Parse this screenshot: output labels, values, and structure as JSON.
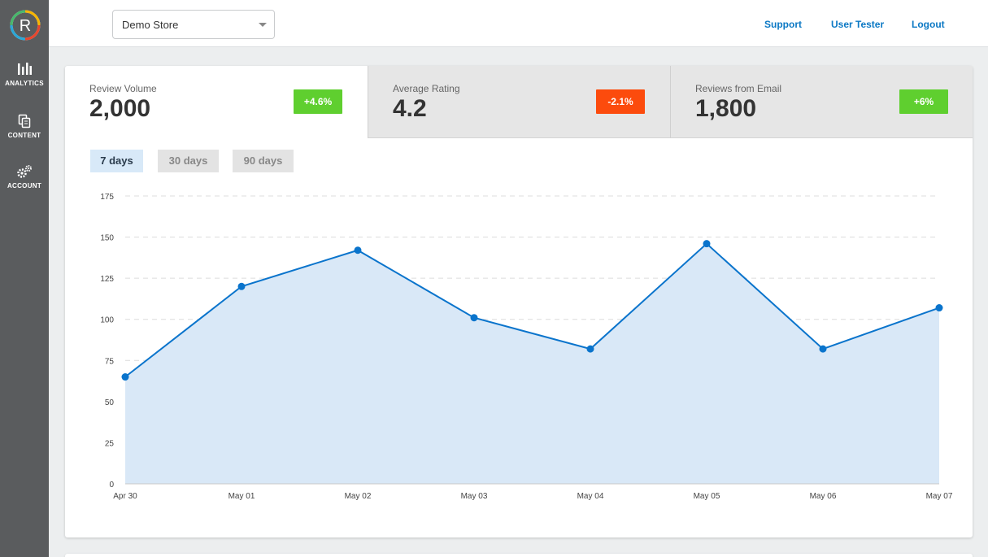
{
  "sidebar": {
    "logo_letter": "R",
    "items": [
      {
        "label": "ANALYTICS",
        "icon": "bar-chart-icon"
      },
      {
        "label": "CONTENT",
        "icon": "documents-icon"
      },
      {
        "label": "ACCOUNT",
        "icon": "gears-icon"
      }
    ]
  },
  "header": {
    "store_selected": "Demo Store",
    "links": [
      "Support",
      "User Tester",
      "Logout"
    ]
  },
  "stats": [
    {
      "label": "Review Volume",
      "value": "2,000",
      "change": "+4.6%",
      "trend": "up"
    },
    {
      "label": "Average Rating",
      "value": "4.2",
      "change": "-2.1%",
      "trend": "down"
    },
    {
      "label": "Reviews from Email",
      "value": "1,800",
      "change": "+6%",
      "trend": "up"
    }
  ],
  "ranges": [
    "7 days",
    "30 days",
    "90 days"
  ],
  "active_range": "7 days",
  "colors": {
    "accent": "#0b78c4",
    "line": "#0a74cc",
    "area": "#d9e8f7",
    "badge_up": "#5fcf2f",
    "badge_down": "#fc4b0d",
    "sidebar": "#5a5c5e"
  },
  "chart_data": {
    "type": "area",
    "x": [
      "Apr 30",
      "May 01",
      "May 02",
      "May 03",
      "May 04",
      "May 05",
      "May 06",
      "May 07"
    ],
    "values": [
      65,
      120,
      142,
      101,
      82,
      146,
      82,
      107
    ],
    "ylim": [
      0,
      175
    ],
    "yticks": [
      0,
      25,
      50,
      75,
      100,
      125,
      150,
      175
    ],
    "grid": true,
    "title": "",
    "xlabel": "",
    "ylabel": ""
  }
}
